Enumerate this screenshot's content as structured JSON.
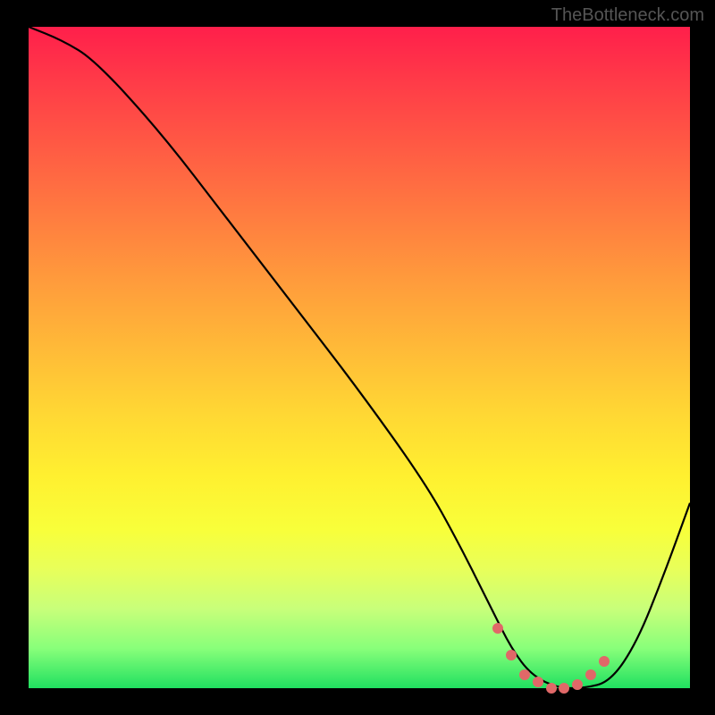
{
  "watermark": "TheBottleneck.com",
  "chart_data": {
    "type": "line",
    "title": "",
    "xlabel": "",
    "ylabel": "",
    "xlim": [
      0,
      100
    ],
    "ylim": [
      0,
      100
    ],
    "series": [
      {
        "name": "curve",
        "x": [
          0,
          5,
          10,
          20,
          30,
          40,
          50,
          60,
          65,
          70,
          73,
          76,
          80,
          84,
          88,
          92,
          96,
          100
        ],
        "y": [
          100,
          98,
          95,
          84,
          71,
          58,
          45,
          31,
          22,
          12,
          6,
          2,
          0,
          0,
          1,
          7,
          17,
          28
        ]
      }
    ],
    "markers": {
      "name": "highlight-zone",
      "x": [
        71,
        73,
        75,
        77,
        79,
        81,
        83,
        85,
        87
      ],
      "y": [
        9,
        5,
        2,
        1,
        0,
        0,
        0.5,
        2,
        4
      ]
    }
  }
}
